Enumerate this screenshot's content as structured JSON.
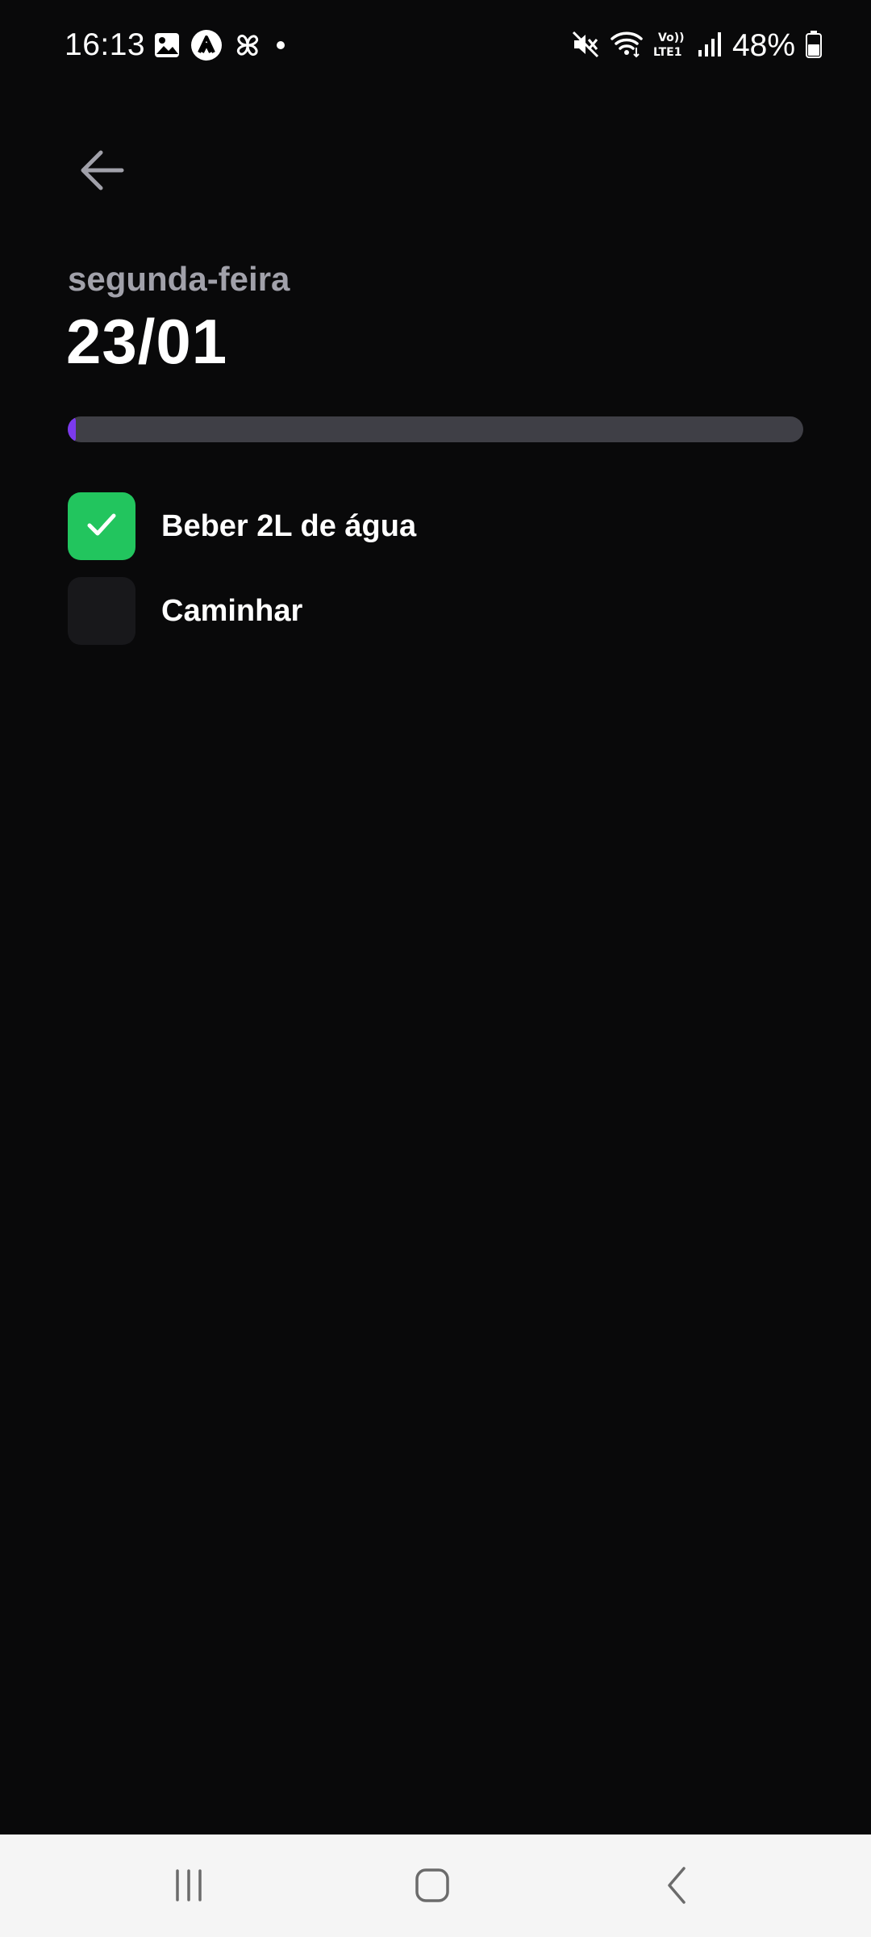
{
  "status_bar": {
    "time": "16:13",
    "battery": "48%",
    "left_icons": [
      "gallery-icon",
      "app-a-icon",
      "pinwheel-icon",
      "dot-icon"
    ],
    "right_icons": [
      "mute-icon",
      "wifi-icon",
      "volte-icon",
      "signal-icon",
      "battery-icon"
    ]
  },
  "header": {
    "weekday": "segunda-feira",
    "date": "23/01"
  },
  "progress": {
    "percent": 1,
    "color": "#7c3aed"
  },
  "habits": [
    {
      "label": "Beber 2L de água",
      "checked": true
    },
    {
      "label": "Caminhar",
      "checked": false
    }
  ],
  "colors": {
    "background": "#09090a",
    "checked": "#22c55e",
    "unchecked": "#18181b",
    "track": "#3f3f46",
    "weekday_text": "#a1a1aa"
  },
  "nav": [
    "recent-apps-icon",
    "home-icon",
    "back-icon"
  ]
}
